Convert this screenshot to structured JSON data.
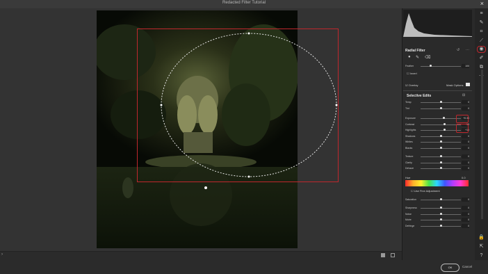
{
  "window": {
    "title": "Redacted Filter Tutorial"
  },
  "panel": {
    "filter_title": "Radial Filter",
    "feather_label": "Feather",
    "feather_value": "100",
    "invert_label": "Invert",
    "overlay_label": "Overlay",
    "mask_options_label": "Mask Options",
    "section_title": "Selective Edits",
    "sliders_group1": [
      {
        "label": "Temp",
        "value": "0",
        "pos": 0.5
      },
      {
        "label": "Tint",
        "value": "0",
        "pos": 0.5
      }
    ],
    "sliders_group2": [
      {
        "label": "Exposure",
        "value": "+0.35",
        "pos": 0.57,
        "highlight": true
      },
      {
        "label": "Contrast",
        "value": "+15",
        "pos": 0.6,
        "highlight": true
      },
      {
        "label": "Highlights",
        "value": "+15",
        "pos": 0.6,
        "highlight": true
      },
      {
        "label": "Shadows",
        "value": "0",
        "pos": 0.5
      },
      {
        "label": "Whites",
        "value": "0",
        "pos": 0.5
      },
      {
        "label": "Blacks",
        "value": "0",
        "pos": 0.5
      }
    ],
    "sliders_group3": [
      {
        "label": "Texture",
        "value": "0",
        "pos": 0.5
      },
      {
        "label": "Clarity",
        "value": "0",
        "pos": 0.5
      },
      {
        "label": "Dehaze",
        "value": "0",
        "pos": 0.5
      }
    ],
    "hue_label": "Hue",
    "hue_value": "0.0",
    "fine_adjust_label": "Use Fine Adjustment",
    "sliders_group4": [
      {
        "label": "Saturation",
        "value": "0",
        "pos": 0.5
      }
    ],
    "sliders_group5": [
      {
        "label": "Sharpness",
        "value": "0",
        "pos": 0.5
      },
      {
        "label": "Noise",
        "value": "0",
        "pos": 0.5
      },
      {
        "label": "Moire",
        "value": "0",
        "pos": 0.5
      },
      {
        "label": "Defringe",
        "value": "0",
        "pos": 0.5
      }
    ]
  },
  "footer": {
    "ok_label": "OK",
    "cancel_label": "Cancel"
  },
  "toolstrip": {
    "icons": [
      "edit-icon",
      "healing-icon",
      "crop-icon",
      "radial-filter-icon",
      "brush-icon",
      "snapshots-icon",
      "more-icon"
    ]
  },
  "colors": {
    "highlight_red": "#c0272d",
    "panel_bg": "#2a2a2a",
    "canvas_bg": "#333333"
  }
}
